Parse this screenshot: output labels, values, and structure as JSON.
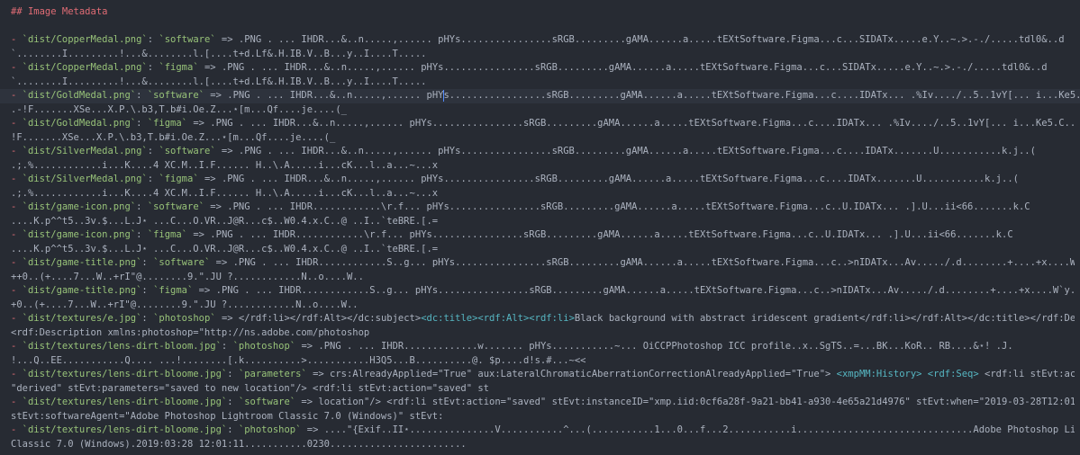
{
  "heading": "## Image Metadata",
  "entries": [
    {
      "path": "`dist/CopperMedal.png`",
      "key": "`software`",
      "rest": " => .PNG . ... IHDR...&..n.....,...... pHYs................sRGB.........gAMA......a.....tEXtSoftware.Figma...c...SIDATx.....e.Y..~.>.-./.....tdl0&..d",
      "cont": "`........I.........!...&........l.[....t+d.Lf&.H.IB.V..B...y..I....T....."
    },
    {
      "path": "`dist/CopperMedal.png`",
      "key": "`figma`",
      "rest": " => .PNG . ... IHDR...&..n.....,...... pHYs................sRGB.........gAMA......a.....tEXtSoftware.Figma...c...SIDATx.....e.Y..~.>.-./.....tdl0&..d",
      "cont": "`........I.........!...&........l.[....t+d.Lf&.H.IB.V..B...y..I....T....."
    },
    {
      "path": "`dist/GoldMedal.png`",
      "key": "`software`",
      "rest_a": " => .PNG . ... IHDR...&..n.....,...... pHY",
      "rest_b": "s.................sRGB.........gAMA......a.....tEXtSoftware.Figma...c....IDATx... .%Iv..../..5..1vY[... i...Ke5.C...+....",
      "cont": ".-!F.......XSe...X.P.\\.b3,T.b#i.Oe.Z...⋆[m...Qf....je....(_"
    },
    {
      "path": "`dist/GoldMedal.png`",
      "key": "`figma`",
      "rest": " => .PNG . ... IHDR...&..n.....,...... pHYs................sRGB.........gAMA......a.....tEXtSoftware.Figma...c....IDATx... .%Iv..../..5..1vY[... i...Ke5.C...+.... .-",
      "cont": "!F.......XSe...X.P.\\.b3,T.b#i.Oe.Z...⋆[m...Qf....je....(_"
    },
    {
      "path": "`dist/SilverMedal.png`",
      "key": "`software`",
      "rest": " => .PNG . ... IHDR...&..n.....,...... pHYs................sRGB.........gAMA......a.....tEXtSoftware.Figma...c....IDATx.......U...........k.j..(",
      "cont": ".;.%............i...K....4 XC.M..I.F...... H..\\.A.....i...cK...l..a...~...x"
    },
    {
      "path": "`dist/SilverMedal.png`",
      "key": "`figma`",
      "rest": " => .PNG . ... IHDR...&..n.....,...... pHYs................sRGB.........gAMA......a.....tEXtSoftware.Figma...c....IDATx.......U...........k.j..(",
      "cont": ".;.%............i...K....4 XC.M..I.F...... H..\\.A.....i...cK...l..a...~...x"
    },
    {
      "path": "`dist/game-icon.png`",
      "key": "`software`",
      "rest": " => .PNG . ... IHDR............\\r.f... pHYs................sRGB.........gAMA......a.....tEXtSoftware.Figma...c..U.IDATx... .].U...ii<66.......k.C",
      "cont": "....K.p^^t5..3v.$...L.J⋆ ...C...O.VR..J@R...c$..W0.4.x.C..@ ..I..`teBRE.[.="
    },
    {
      "path": "`dist/game-icon.png`",
      "key": "`figma`",
      "rest": " => .PNG . ... IHDR............\\r.f... pHYs................sRGB.........gAMA......a.....tEXtSoftware.Figma...c..U.IDATx... .].U...ii<66.......k.C",
      "cont": "....K.p^^t5..3v.$...L.J⋆ ...C...O.VR..J@R...c$..W0.4.x.C..@ ..I..`teBRE.[.="
    },
    {
      "path": "`dist/game-title.png`",
      "key": "`software`",
      "rest": " => .PNG . ... IHDR............S..g... pHYs................sRGB.........gAMA......a.....tEXtSoftware.Figma...c..>nIDATx...Av...../.d........+....+x....W`y...=qy..",
      "cont": "++0..(+....7...W..+rI\"@........9.\".JU ?............N..o....W.."
    },
    {
      "path": "`dist/game-title.png`",
      "key": "`figma`",
      "rest": " => .PNG . ... IHDR............S..g... pHYs................sRGB.........gAMA......a.....tEXtSoftware.Figma...c..>nIDATx...Av...../.d........+....+x....W`y...=qy..+",
      "cont": "+0..(+....7...W..+rI\"@........9.\".JU ?............N..o....W.."
    },
    {
      "path": "`dist/textures/e.jpg`",
      "key": "`photoshop`",
      "rest_a": " => </rdf:li></rdf:Alt></dc:subject>",
      "tag": "<dc:title><rdf:Alt><rdf:li>",
      "rest_b": "Black background with abstract iridescent gradient</rdf:li></rdf:Alt></dc:title></rdf:Description>",
      "cont": "<rdf:Description xmlns:photoshop=\"http://ns.adobe.com/photoshop"
    },
    {
      "path": "`dist/textures/lens-dirt-bloom.jpg`",
      "key": "`photoshop`",
      "rest": " => .PNG . ... IHDR.............w....... pHYs...........~... OiCCPPhotoshop ICC profile..x..SgTS..=...BK...KoR.. RB....&⋆! .J.",
      "cont": "!...Q..EE...........Q.... ...!........[.k..........>...........H3Q5...B..........@. $p....d!s.#...~<<"
    },
    {
      "path": "`dist/textures/lens-dirt-bloome.jpg`",
      "key": "`parameters`",
      "rest_a": " => crs:AlreadyApplied=\"True\" aux:LateralChromaticAberrationCorrectionAlreadyApplied=\"True\"> ",
      "tag": "<xmpMM:History> <rdf:Seq>",
      "rest_b": " <rdf:li stEvt:action=",
      "cont": "\"derived\" stEvt:parameters=\"saved to new location\"/> <rdf:li stEvt:action=\"saved\" st"
    },
    {
      "path": "`dist/textures/lens-dirt-bloome.jpg`",
      "key": "`software`",
      "rest": " => location\"/> <rdf:li stEvt:action=\"saved\" stEvt:instanceID=\"xmp.iid:0cf6a28f-9a21-bb41-a930-4e65a21d4976\" stEvt:when=\"2019-03-28T12:01:11+01:00\"",
      "cont": "stEvt:softwareAgent=\"Adobe Photoshop Lightroom Classic 7.0 (Windows)\" stEvt:"
    },
    {
      "path": "`dist/textures/lens-dirt-bloome.jpg`",
      "key": "`photoshop`",
      "rest": " => ....\"{Exif..II⋆...............V...........^...(...........1...0...f...2...........i...............................Adobe Photoshop Lightroom",
      "cont": "Classic 7.0 (Windows).2019:03:28 12:01:11...........0230........................"
    }
  ]
}
